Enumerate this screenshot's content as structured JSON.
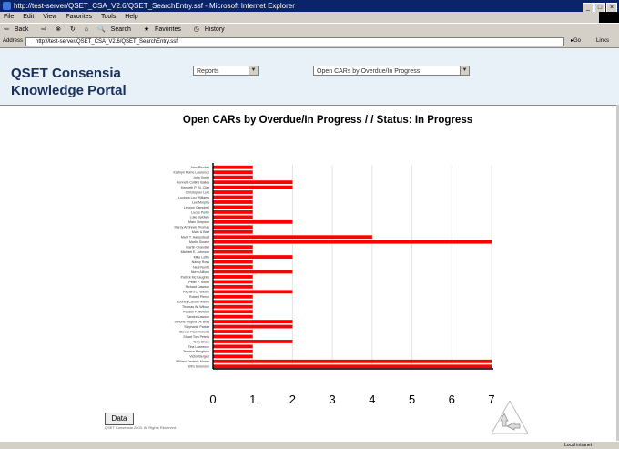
{
  "window": {
    "title": "http://test-server/QSET_CSA_V2.6/QSET_SearchEntry.ssf - Microsoft Internet Explorer"
  },
  "menu": [
    "File",
    "Edit",
    "View",
    "Favorites",
    "Tools",
    "Help"
  ],
  "toolbar": [
    "Back",
    "Search",
    "Favorites",
    "History"
  ],
  "address": {
    "label": "Address",
    "url": "http://test-server/QSET_CSA_V2.6/QSET_SearchEntry.ssf",
    "go": "Go",
    "links": "Links"
  },
  "portal": {
    "title_line1": "QSET Consensia",
    "title_line2": "Knowledge Portal",
    "reports_select": "Reports",
    "report_select": "Open CARs by Overdue/In Progress"
  },
  "data_button": "Data",
  "footnote": "QSET Consensia 2003. All Rights Reserved.",
  "status": {
    "zone": "Local intranet"
  },
  "colors": {
    "bar": "#ff0000",
    "header_bg": "#e8f0f8"
  },
  "chart_data": {
    "type": "bar",
    "orientation": "horizontal",
    "title": "Open CARs by Overdue/In Progress / / Status: In Progress",
    "xlim": [
      0,
      7
    ],
    "xticks": [
      0,
      1,
      2,
      3,
      4,
      5,
      6,
      7
    ],
    "grid": true,
    "categories": [
      "John Rhodes",
      "Kathryn Rome Lawrence",
      "John Smith",
      "Kenneth Collins Bailey",
      "Kenneth P. St. Clair",
      "Christopher Lutz",
      "Lucinda Lou Williams",
      "Lee Murphy",
      "Lennon Campbell",
      "Lucas Perlin",
      "Luke Baldwin",
      "Marc Simpson",
      "Marcy Andrews Thomas",
      "Mark & Barr",
      "Mark T. Hampstead",
      "Martin Sloane",
      "Martin Chandler",
      "Michael E. Johnson",
      "Mike Loftin",
      "Nancy Ross",
      "Neal Norris",
      "Norm Allison",
      "Patrick Mc Laughlin",
      "Peter P. Smith",
      "Richard Dawson",
      "Richard C. Wilson",
      "Robert Pierce",
      "Rodney Carson Martin",
      "Thomas W. Wilson",
      "Russell P. Newton",
      "Sandra Lawson",
      "Simone Regula De Bray",
      "Stephanie Parker",
      "Steven Paul Roberts",
      "Stuart Tom Peters",
      "Terry Shaw",
      "Tina Lawrence",
      "Terence Bengtson",
      "Victor Bergen",
      "William Frederic Moran",
      "Wim Sorenson"
    ],
    "values": [
      1,
      1,
      1,
      2,
      2,
      1,
      1,
      1,
      1,
      1,
      1,
      2,
      1,
      1,
      4,
      7,
      1,
      1,
      2,
      1,
      1,
      2,
      1,
      1,
      1,
      2,
      1,
      1,
      1,
      1,
      1,
      2,
      2,
      1,
      1,
      2,
      1,
      1,
      1,
      7,
      7
    ]
  }
}
